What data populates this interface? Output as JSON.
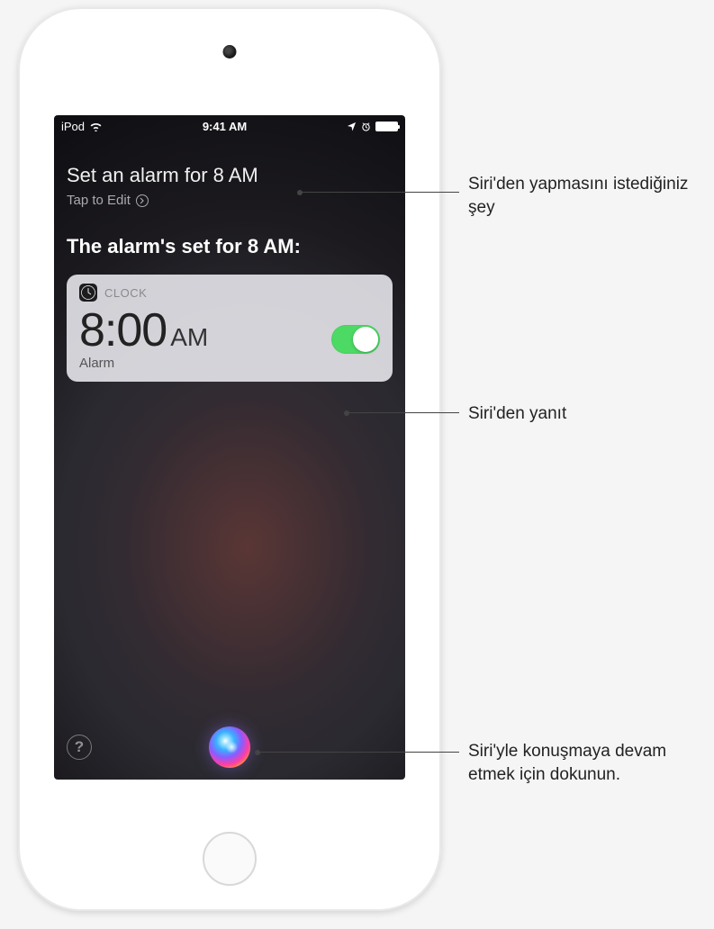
{
  "status_bar": {
    "carrier": "iPod",
    "time": "9:41 AM"
  },
  "siri": {
    "user_request": "Set an alarm for 8 AM",
    "tap_to_edit": "Tap to Edit",
    "response": "The alarm's set for 8 AM:"
  },
  "clock_card": {
    "app_name": "CLOCK",
    "time": "8:00",
    "ampm": "AM",
    "label": "Alarm",
    "toggle_on": true
  },
  "help_glyph": "?",
  "callouts": {
    "request": "Siri'den yapmasını istediğiniz şey",
    "response": "Siri'den yanıt",
    "orb": "Siri'yle konuşmaya devam etmek için dokunun."
  }
}
